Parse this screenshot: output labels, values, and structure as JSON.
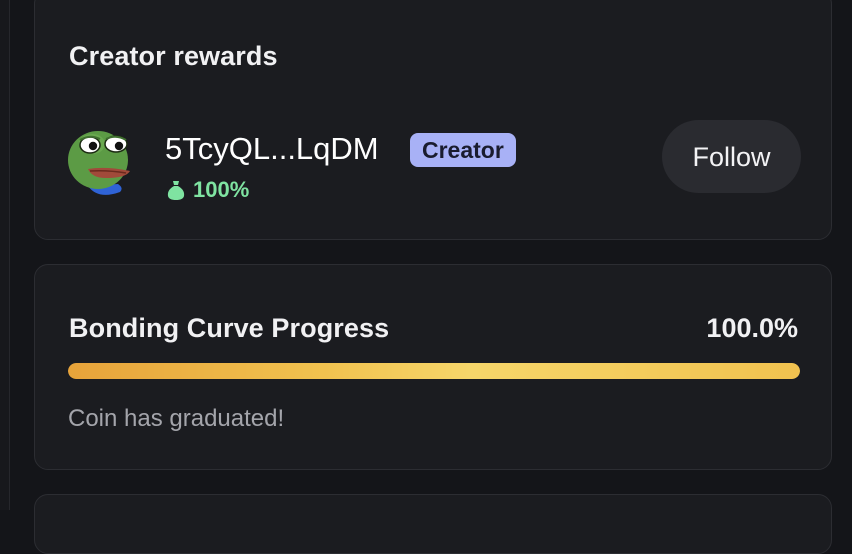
{
  "creator_rewards": {
    "title": "Creator rewards",
    "creator": {
      "address": "5TcyQL...LqDM",
      "badge": "Creator",
      "share": "100%",
      "share_icon": "money-bag-icon",
      "avatar": "pepe-frog-avatar"
    },
    "follow_label": "Follow"
  },
  "bonding_curve": {
    "title": "Bonding Curve Progress",
    "percent_label": "100.0%",
    "progress": 1.0,
    "status": "Coin has graduated!"
  },
  "colors": {
    "background": "#141519",
    "card": "#1b1c20",
    "badge": "#a8b1f6",
    "share_green": "#7fe3a1",
    "progress_start": "#e7a33a",
    "progress_end": "#f1c24f"
  }
}
